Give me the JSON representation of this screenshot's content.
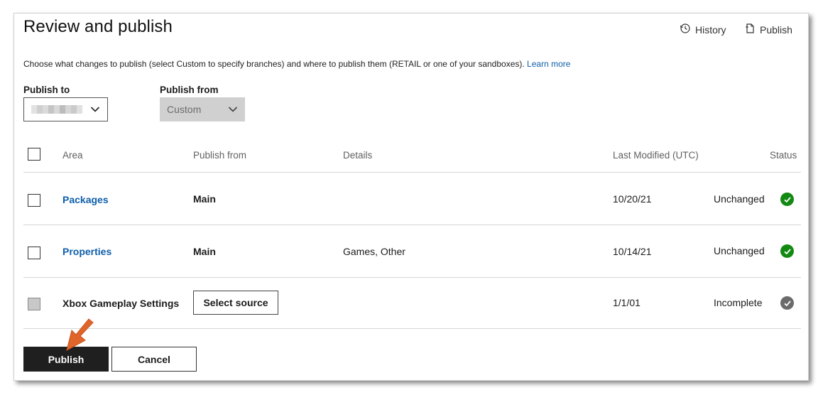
{
  "header": {
    "title": "Review and publish",
    "history_label": "History",
    "publish_label": "Publish",
    "description": "Choose what changes to publish (select Custom to specify branches) and where to publish them (RETAIL or one of your sandboxes).",
    "learn_more": "Learn more"
  },
  "publish_to": {
    "label": "Publish to",
    "value": ""
  },
  "publish_from": {
    "label": "Publish from",
    "value": "Custom"
  },
  "table": {
    "columns": [
      "Area",
      "Publish from",
      "Details",
      "Last Modified (UTC)",
      "Status"
    ],
    "rows": [
      {
        "area": "Packages",
        "publish_from": "Main",
        "details": "",
        "last_modified": "10/20/21",
        "status": "Unchanged"
      },
      {
        "area": "Properties",
        "publish_from": "Main",
        "details": "Games, Other",
        "last_modified": "10/14/21",
        "status": "Unchanged"
      },
      {
        "area": "Xbox Gameplay Settings",
        "publish_from": "Select source",
        "details": "",
        "last_modified": "1/1/01",
        "status": "Incomplete"
      }
    ]
  },
  "footer": {
    "publish_button": "Publish",
    "cancel_button": "Cancel"
  },
  "colors": {
    "accent_link": "#0f5fa9",
    "status_ok": "#128a12",
    "status_incomplete": "#6b6b6b",
    "annotation_arrow": "#e0652b"
  }
}
